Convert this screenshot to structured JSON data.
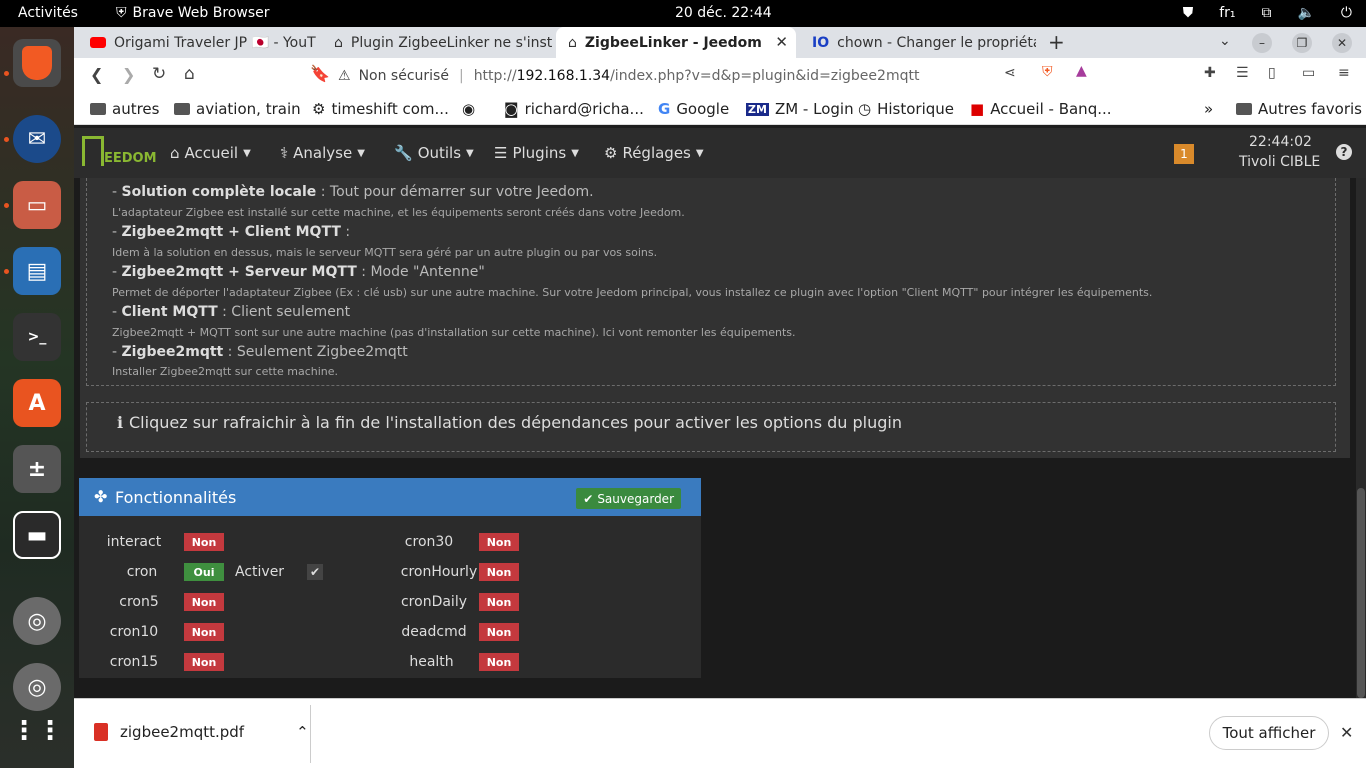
{
  "system": {
    "activities": "Activités",
    "app_name": "Brave Web Browser",
    "clock": "20 déc.  22:44",
    "lang": "fr₁"
  },
  "tabs": [
    {
      "title": "Origami Traveler JP 🇯🇵 - YouT"
    },
    {
      "title": "Plugin ZigbeeLinker ne s'insta"
    },
    {
      "title": "ZigbeeLinker - Jeedom"
    },
    {
      "title": "chown - Changer le propriétai"
    }
  ],
  "new_tab": "+",
  "nav": {
    "insecure": "Non sécurisé",
    "url_prefix": "http://",
    "url_host": "192.168.1.34",
    "url_path": "/index.php?v=d&p=plugin&id=zigbee2mqtt"
  },
  "bookmarks": [
    {
      "label": "autres"
    },
    {
      "label": "aviation, train"
    },
    {
      "label": "timeshift com..."
    },
    {
      "label": ""
    },
    {
      "label": "richard@richa..."
    },
    {
      "label": "Google"
    },
    {
      "label": "ZM - Login"
    },
    {
      "label": "Historique"
    },
    {
      "label": "Accueil - Banq..."
    }
  ],
  "bookmarks_more": "»",
  "bookmarks_other": "Autres favoris",
  "jeedom": {
    "logo": "EEDOM",
    "menu": [
      {
        "label": "Accueil"
      },
      {
        "label": "Analyse"
      },
      {
        "label": "Outils"
      },
      {
        "label": "Plugins"
      },
      {
        "label": "Réglages"
      }
    ],
    "notif_count": "1",
    "time": "22:44:02",
    "user": "Tivoli CIBLE"
  },
  "modes": [
    {
      "name": "Solution complète locale",
      "desc": " : Tout pour démarrer sur votre Jeedom.",
      "detail": "L'adaptateur Zigbee est installé sur cette machine, et les équipements seront créés dans votre Jeedom."
    },
    {
      "name": "Zigbee2mqtt + Client MQTT",
      "desc": " :",
      "detail": "Idem à la solution en dessus, mais le serveur MQTT sera géré par un autre plugin ou par vos soins."
    },
    {
      "name": "Zigbee2mqtt + Serveur MQTT",
      "desc": " : Mode \"Antenne\"",
      "detail": "Permet de déporter l'adaptateur Zigbee (Ex : clé usb) sur une autre machine. Sur votre Jeedom principal, vous installez ce plugin avec l'option \"Client MQTT\" pour intégrer les équipements."
    },
    {
      "name": "Client MQTT",
      "desc": " : Client seulement",
      "detail": "Zigbee2mqtt + MQTT sont sur une autre machine (pas d'installation sur cette machine). Ici vont remonter les équipements."
    },
    {
      "name": "Zigbee2mqtt",
      "desc": " : Seulement Zigbee2mqtt",
      "detail": "Installer Zigbee2mqtt sur cette machine."
    }
  ],
  "mode_prefix": "- ",
  "info_text": "Cliquez sur rafraichir à la fin de l'installation des dépendances pour activer les options du plugin",
  "features": {
    "title": "Fonctionnalités",
    "save": "Sauvegarder",
    "left": [
      {
        "name": "interact",
        "status": "Non"
      },
      {
        "name": "cron",
        "status": "Oui"
      },
      {
        "name": "cron5",
        "status": "Non"
      },
      {
        "name": "cron10",
        "status": "Non"
      },
      {
        "name": "cron15",
        "status": "Non"
      }
    ],
    "right": [
      {
        "name": "cron30",
        "status": "Non"
      },
      {
        "name": "cronHourly",
        "status": "Non"
      },
      {
        "name": "cronDaily",
        "status": "Non"
      },
      {
        "name": "deadcmd",
        "status": "Non"
      },
      {
        "name": "health",
        "status": "Non"
      }
    ],
    "activate_label": "Activer"
  },
  "download": {
    "file": "zigbee2mqtt.pdf",
    "show_all": "Tout afficher"
  },
  "colors": {
    "accent_blue": "#3a7bbf",
    "no_red": "#c4393e",
    "yes_green": "#3f8f3f",
    "notif_orange": "#d98a2b"
  }
}
